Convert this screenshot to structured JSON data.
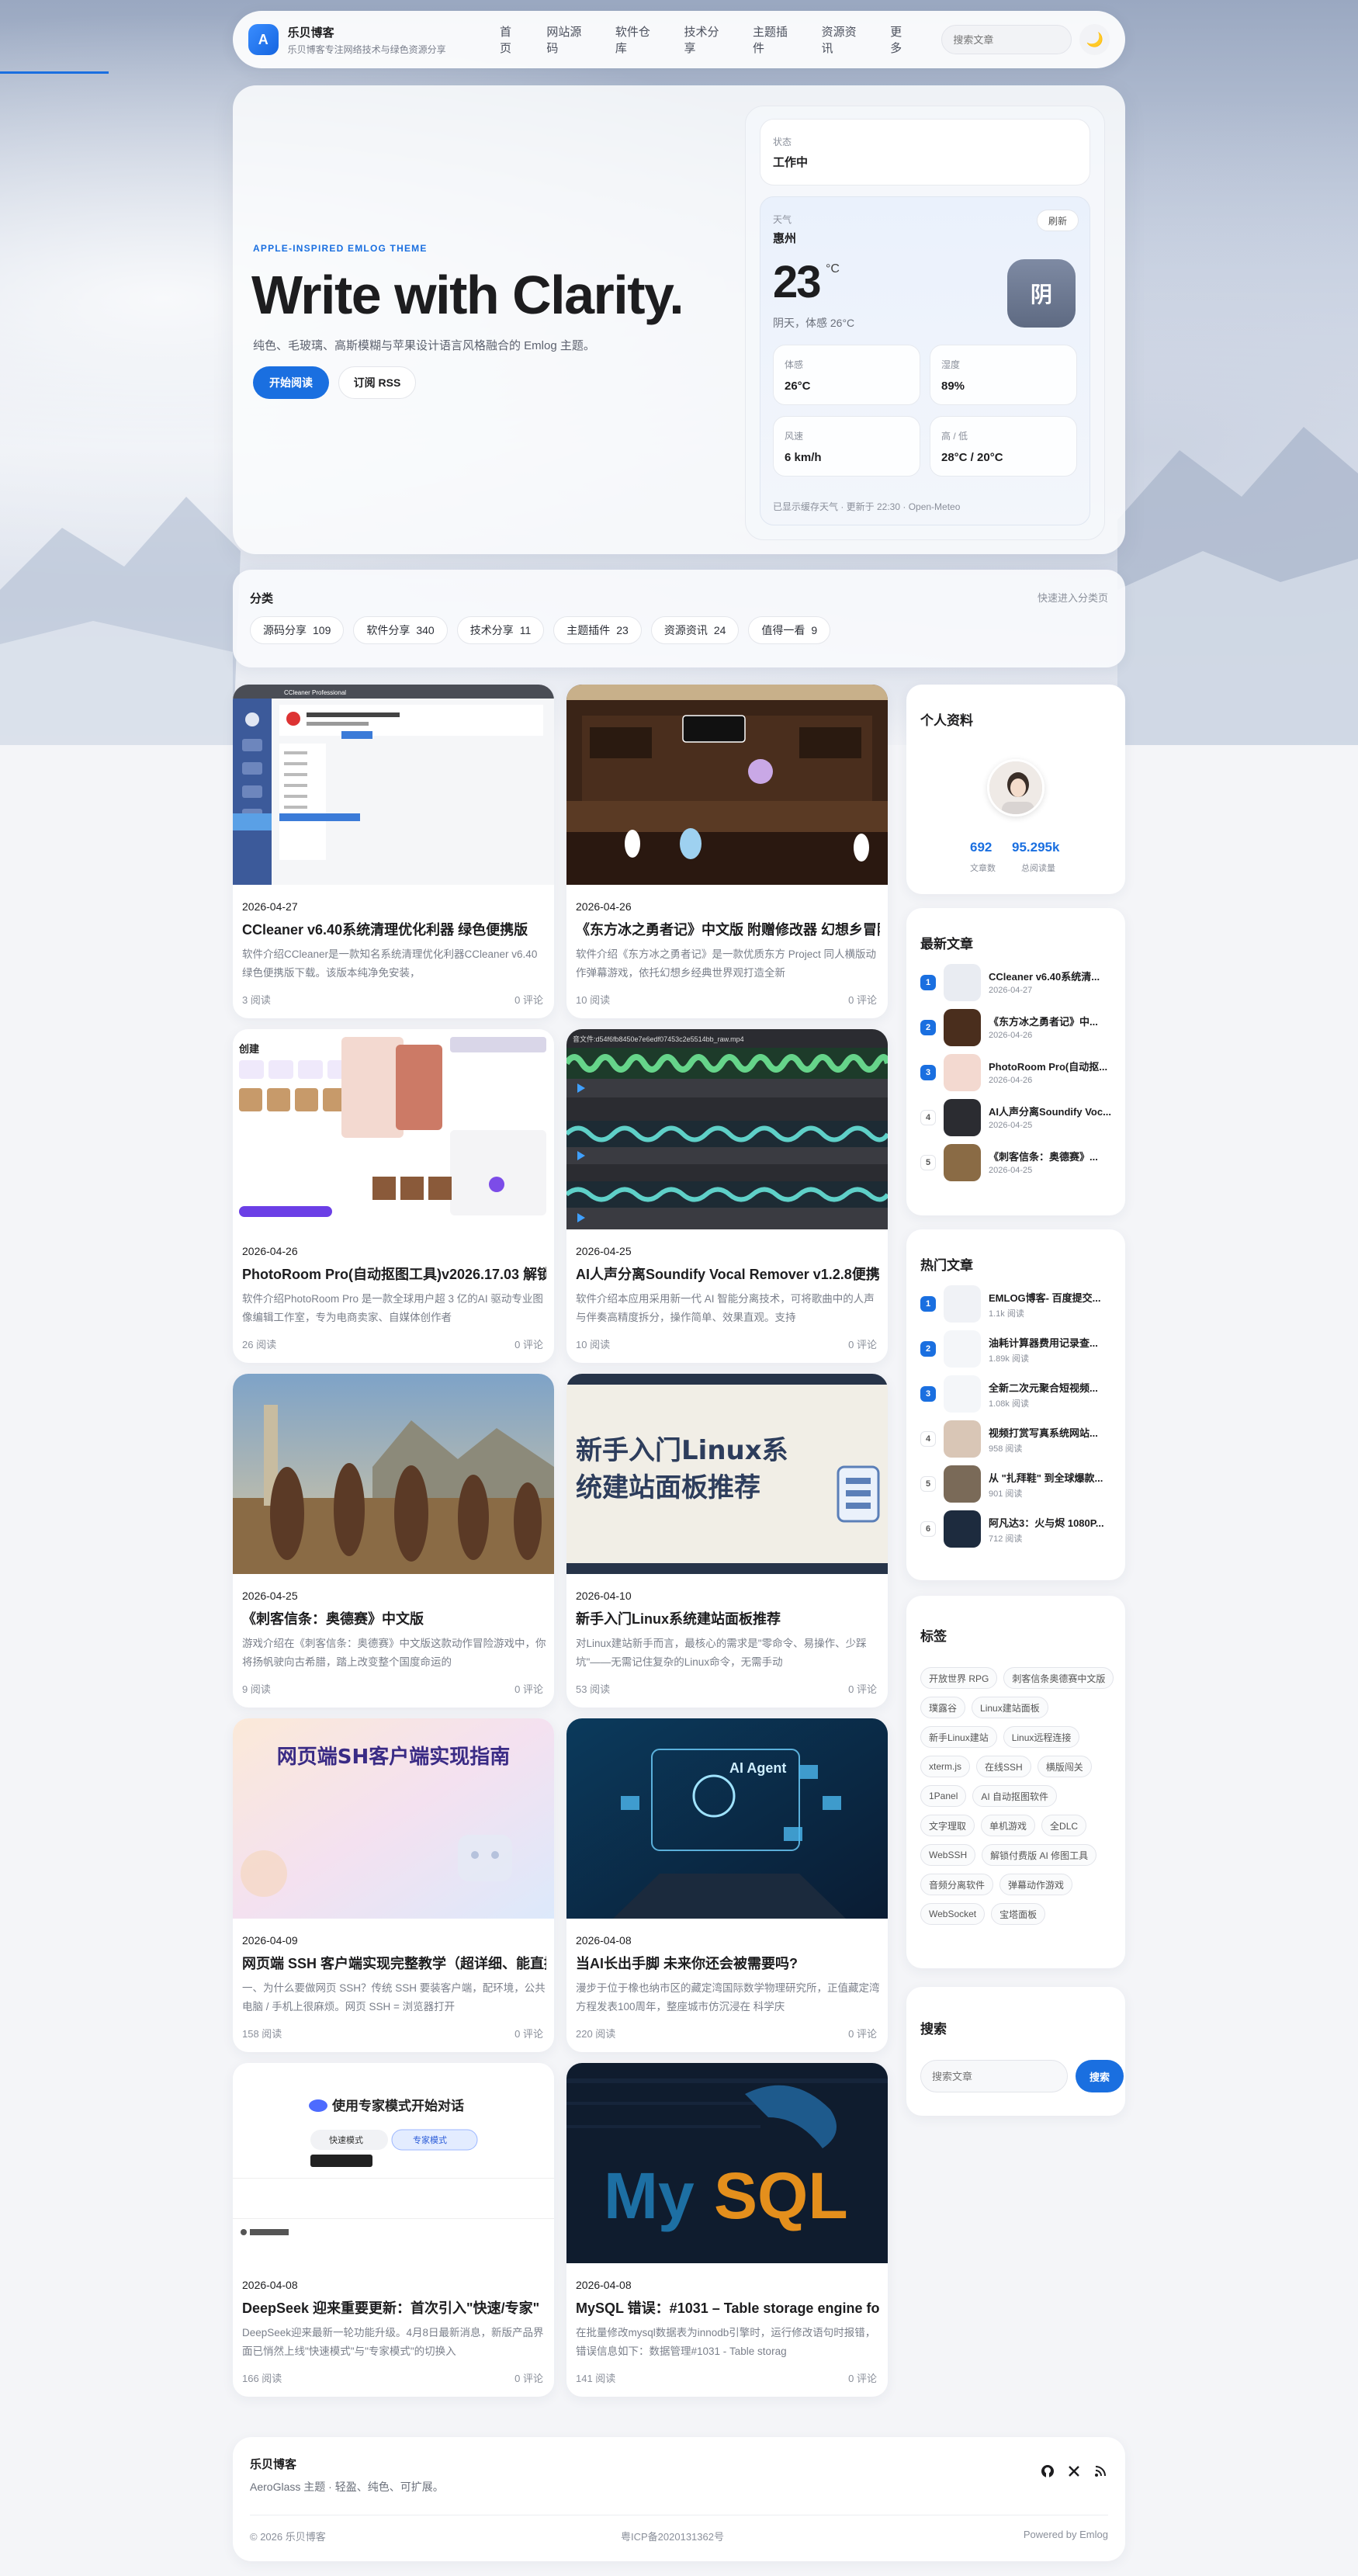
{
  "nav": {
    "logo_letter": "A",
    "brand_name": "乐贝博客",
    "brand_sub": "乐贝博客专注网络技术与绿色资源分享",
    "links": [
      "首页",
      "网站源码",
      "软件仓库",
      "技术分享",
      "主题插件",
      "资源资讯",
      "更多"
    ],
    "search_placeholder": "搜索文章",
    "theme_icon": "moon-icon",
    "theme_glyph": "🌙"
  },
  "hero": {
    "eyebrow": "APPLE-INSPIRED EMLOG THEME",
    "title": "Write with Clarity.",
    "desc": "纯色、毛玻璃、高斯模糊与苹果设计语言风格融合的 Emlog 主题。",
    "primary_btn": "开始阅读",
    "secondary_btn": "订阅 RSS"
  },
  "status": {
    "label": "状态",
    "value": "工作中"
  },
  "weather": {
    "label": "天气",
    "city": "惠州",
    "refresh": "刷新",
    "temp": "23",
    "unit": "°C",
    "condition": "阴天，体感 26°C",
    "icon_text": "阴",
    "metrics": [
      {
        "label": "体感",
        "value": "26°C"
      },
      {
        "label": "湿度",
        "value": "89%"
      },
      {
        "label": "风速",
        "value": "6 km/h"
      },
      {
        "label": "高 / 低",
        "value": "28°C / 20°C"
      }
    ],
    "footer": "已显示缓存天气 · 更新于 22:30 · Open-Meteo"
  },
  "categories": {
    "title": "分类",
    "link": "快速进入分类页",
    "items": [
      {
        "name": "源码分享",
        "count": "109"
      },
      {
        "name": "软件分享",
        "count": "340"
      },
      {
        "name": "技术分享",
        "count": "11"
      },
      {
        "name": "主题插件",
        "count": "23"
      },
      {
        "name": "资源资讯",
        "count": "24"
      },
      {
        "name": "值得一看",
        "count": "9"
      }
    ]
  },
  "posts": [
    {
      "date": "2026-04-27",
      "title": "CCleaner v6.40系统清理优化利器 绿色便携版",
      "excerpt": "软件介绍CCleaner是一款知名系统清理优化利器CCleaner v6.40 绿色便携版下载。该版本纯净免安装，",
      "views": "3 阅读",
      "comments": "0 评论"
    },
    {
      "date": "2026-04-26",
      "title": "《东方冰之勇者记》中文版 附赠修改器 幻想乡冒险",
      "excerpt": "软件介绍《东方冰之勇者记》是一款优质东方 Project 同人横版动作弹幕游戏，依托幻想乡经典世界观打造全新",
      "views": "10 阅读",
      "comments": "0 评论"
    },
    {
      "date": "2026-04-26",
      "title": "PhotoRoom Pro(自动抠图工具)v2026.17.03 解锁",
      "excerpt": "软件介绍PhotoRoom Pro 是一款全球用户超 3 亿的AI 驱动专业图像编辑工作室，专为电商卖家、自媒体创作者",
      "views": "26 阅读",
      "comments": "0 评论"
    },
    {
      "date": "2026-04-25",
      "title": "AI人声分离Soundify Vocal Remover v1.2.8便携",
      "excerpt": "软件介绍本应用采用新一代 AI 智能分离技术，可将歌曲中的人声与伴奏高精度拆分，操作简单、效果直观。支持",
      "views": "10 阅读",
      "comments": "0 评论"
    },
    {
      "date": "2026-04-25",
      "title": "《刺客信条：奥德赛》中文版",
      "excerpt": "游戏介绍在《刺客信条：奥德赛》中文版这款动作冒险游戏中，你将扬帆驶向古希腊，踏上改变整个国度命运的",
      "views": "9 阅读",
      "comments": "0 评论"
    },
    {
      "date": "2026-04-10",
      "title": "新手入门Linux系统建站面板推荐",
      "excerpt": "对Linux建站新手而言，最核心的需求是\"零命令、易操作、少踩坑\"——无需记住复杂的Linux命令，无需手动",
      "views": "53 阅读",
      "comments": "0 评论"
    },
    {
      "date": "2026-04-09",
      "title": "网页端 SSH 客户端实现完整教学（超详细、能直接",
      "excerpt": "一、为什么要做网页 SSH？传统 SSH 要装客户端，配环境，公共电脑 / 手机上很麻烦。网页 SSH = 浏览器打开",
      "views": "158 阅读",
      "comments": "0 评论"
    },
    {
      "date": "2026-04-08",
      "title": "当AI长出手脚 未来你还会被需要吗?",
      "excerpt": "漫步于位于橡也纳市区的藏定湾国际数学物理研究所，正值藏定湾方程发表100周年，整座城市仿沉浸在 科学庆",
      "views": "220 阅读",
      "comments": "0 评论"
    },
    {
      "date": "2026-04-08",
      "title": "DeepSeek 迎来重要更新：首次引入\"快速/专家\"",
      "excerpt": "DeepSeek迎来最新一轮功能升级。4月8日最新消息，新版产品界面已悄然上线\"快速模式\"与\"专家模式\"的切换入",
      "views": "166 阅读",
      "comments": "0 评论"
    },
    {
      "date": "2026-04-08",
      "title": "MySQL 错误：#1031 – Table storage engine fo",
      "excerpt": "在批量修改mysql数据表为innodb引擎时，运行修改语句时报错，错误信息如下：数据管理#1031 - Table storag",
      "views": "141 阅读",
      "comments": "0 评论"
    }
  ],
  "thumb_text": {
    "linux": "新手入门Linux系\n统建站面板推荐",
    "ssh": "网页端SH客户端实现指南",
    "deepseek": "使用专家模式开始对话",
    "deepseek_fast": "快速模式",
    "deepseek_expert": "专家模式",
    "mysql": "MySQL",
    "ai": "AI Agent",
    "cc": "CCleaner Professional",
    "pr1": "创建",
    "audio": "音文件:d54f6fb8450e7e6edf07453c2e5514bb_raw.mp4"
  },
  "profile": {
    "title": "个人资料",
    "articles": "692",
    "articles_label": "文章数",
    "views": "95.295k",
    "views_label": "总阅读量"
  },
  "latest": {
    "title": "最新文章",
    "items": [
      {
        "num": "1",
        "title": "CCleaner v6.40系统清...",
        "date": "2026-04-27"
      },
      {
        "num": "2",
        "title": "《东方冰之勇者记》中...",
        "date": "2026-04-26"
      },
      {
        "num": "3",
        "title": "PhotoRoom Pro(自动抠...",
        "date": "2026-04-26"
      },
      {
        "num": "4",
        "title": "AI人声分离Soundify Voc...",
        "date": "2026-04-25"
      },
      {
        "num": "5",
        "title": "《刺客信条：奥德赛》...",
        "date": "2026-04-25"
      }
    ]
  },
  "hot": {
    "title": "热门文章",
    "items": [
      {
        "num": "1",
        "title": "EMLOG博客- 百度提交...",
        "meta": "1.1k 阅读"
      },
      {
        "num": "2",
        "title": "油耗计算器费用记录查...",
        "meta": "1.89k 阅读"
      },
      {
        "num": "3",
        "title": "全新二次元聚合短视频...",
        "meta": "1.08k 阅读"
      },
      {
        "num": "4",
        "title": "视频打赏写真系统网站...",
        "meta": "958 阅读"
      },
      {
        "num": "5",
        "title": "从 \"扎拜鞋\" 到全球爆款...",
        "meta": "901 阅读"
      },
      {
        "num": "6",
        "title": "阿凡达3：火与烬 1080P...",
        "meta": "712 阅读"
      }
    ]
  },
  "tags": {
    "title": "标签",
    "items": [
      "开放世界 RPG",
      "刺客信条奥德赛中文版",
      "璞露谷",
      "Linux建站面板",
      "新手Linux建站",
      "Linux远程连接",
      "xterm.js",
      "在线SSH",
      "横版闯关",
      "1Panel",
      "AI 自动抠图软件",
      "文字理取",
      "单机游戏",
      "全DLC",
      "WebSSH",
      "解锁付费版 AI 修图工具",
      "音频分离软件",
      "弹幕动作游戏",
      "WebSocket",
      "宝塔面板"
    ]
  },
  "side_search": {
    "title": "搜索",
    "placeholder": "搜索文章",
    "button": "搜索"
  },
  "footer": {
    "name": "乐贝博客",
    "tagline": "AeroGlass 主题 · 轻盈、纯色、可扩展。",
    "copyright": "© 2026 乐贝博客",
    "icp": "粤ICP备2020131362号",
    "powered": "Powered by Emlog",
    "icons": [
      "github-icon",
      "x-icon",
      "rss-icon"
    ]
  }
}
